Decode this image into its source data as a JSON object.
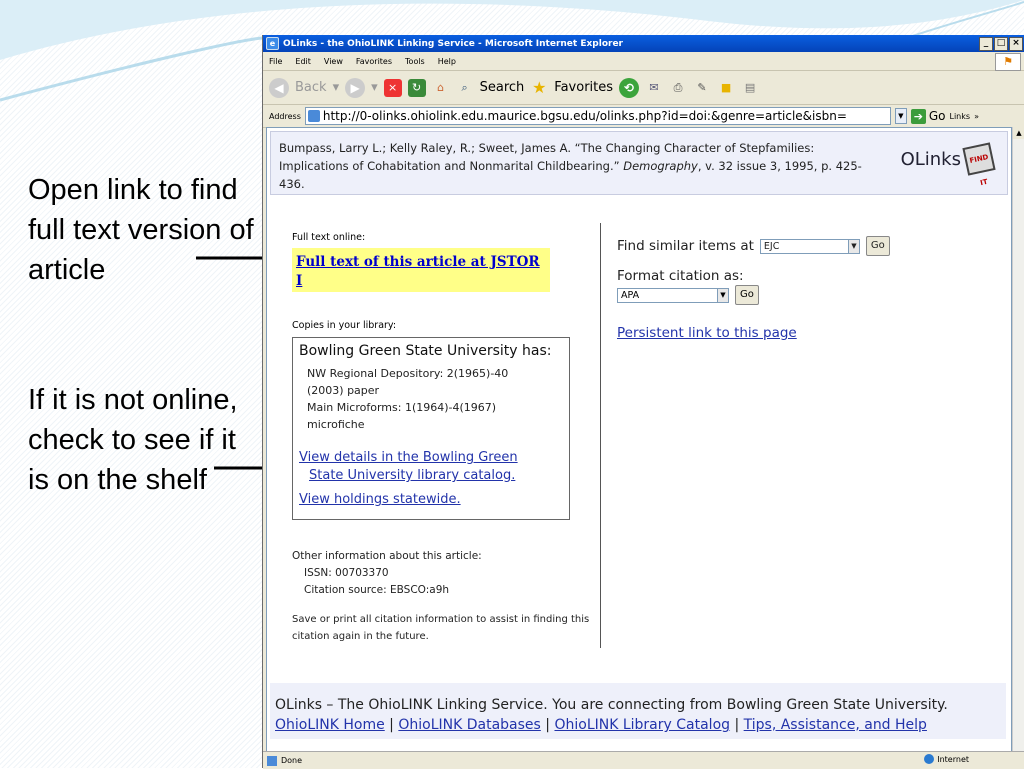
{
  "annotations": {
    "first": "Open link to find full text version of article",
    "second": "If it is not online, check to see if it is on the shelf"
  },
  "browser": {
    "title": "OLinks - the OhioLINK Linking Service - Microsoft Internet Explorer",
    "menu": [
      "File",
      "Edit",
      "View",
      "Favorites",
      "Tools",
      "Help"
    ],
    "toolbar": {
      "back": "Back",
      "search": "Search",
      "favorites": "Favorites"
    },
    "address_label": "Address",
    "address_url": "http://0-olinks.ohiolink.edu.maurice.bgsu.edu/olinks.php?id=doi:&genre=article&isbn=",
    "go_label": "Go",
    "links_label": "Links",
    "status_text": "Done",
    "zone_text": "Internet"
  },
  "citation": {
    "authors_title": "Bumpass, Larry L.; Kelly Raley, R.; Sweet, James A. “The Changing Character of Stepfamilies: Implications of Cohabitation and Nonmarital Childbearing.” ",
    "journal": "Demography",
    "details": ", v. 32 issue 3, 1995, p. 425-436."
  },
  "logo": {
    "text": "OLinks",
    "icon_text": "FIND IT"
  },
  "full_text": {
    "label": "Full text online:",
    "link": "Full text of this article at JSTOR I"
  },
  "library": {
    "label": "Copies in your library:",
    "title": "Bowling Green State University has:",
    "holdings": [
      "NW Regional Depository: 2(1965)-40",
      "(2003) paper",
      "Main Microforms: 1(1964)-4(1967)",
      "microfiche"
    ],
    "catalog_link_1": "View details in the Bowling Green",
    "catalog_link_2": "State University library catalog.",
    "statewide_link": "View holdings statewide."
  },
  "other_info": {
    "label": "Other information about this article:",
    "issn": "ISSN: 00703370",
    "source": "Citation source: EBSCO:a9h"
  },
  "save_note": "Save or print all citation information to assist in finding this citation again in the future.",
  "right": {
    "find_label": "Find similar items at",
    "find_value": "EJC",
    "go": "Go",
    "format_label": "Format citation as:",
    "format_value": "APA",
    "persistent_link": "Persistent link to this page"
  },
  "footer": {
    "line1": "OLinks – The OhioLINK Linking Service. You are connecting from Bowling Green State University.",
    "links": [
      "OhioLINK Home",
      "OhioLINK Databases",
      "OhioLINK Library Catalog",
      "Tips, Assistance, and Help"
    ],
    "separator": " | "
  }
}
